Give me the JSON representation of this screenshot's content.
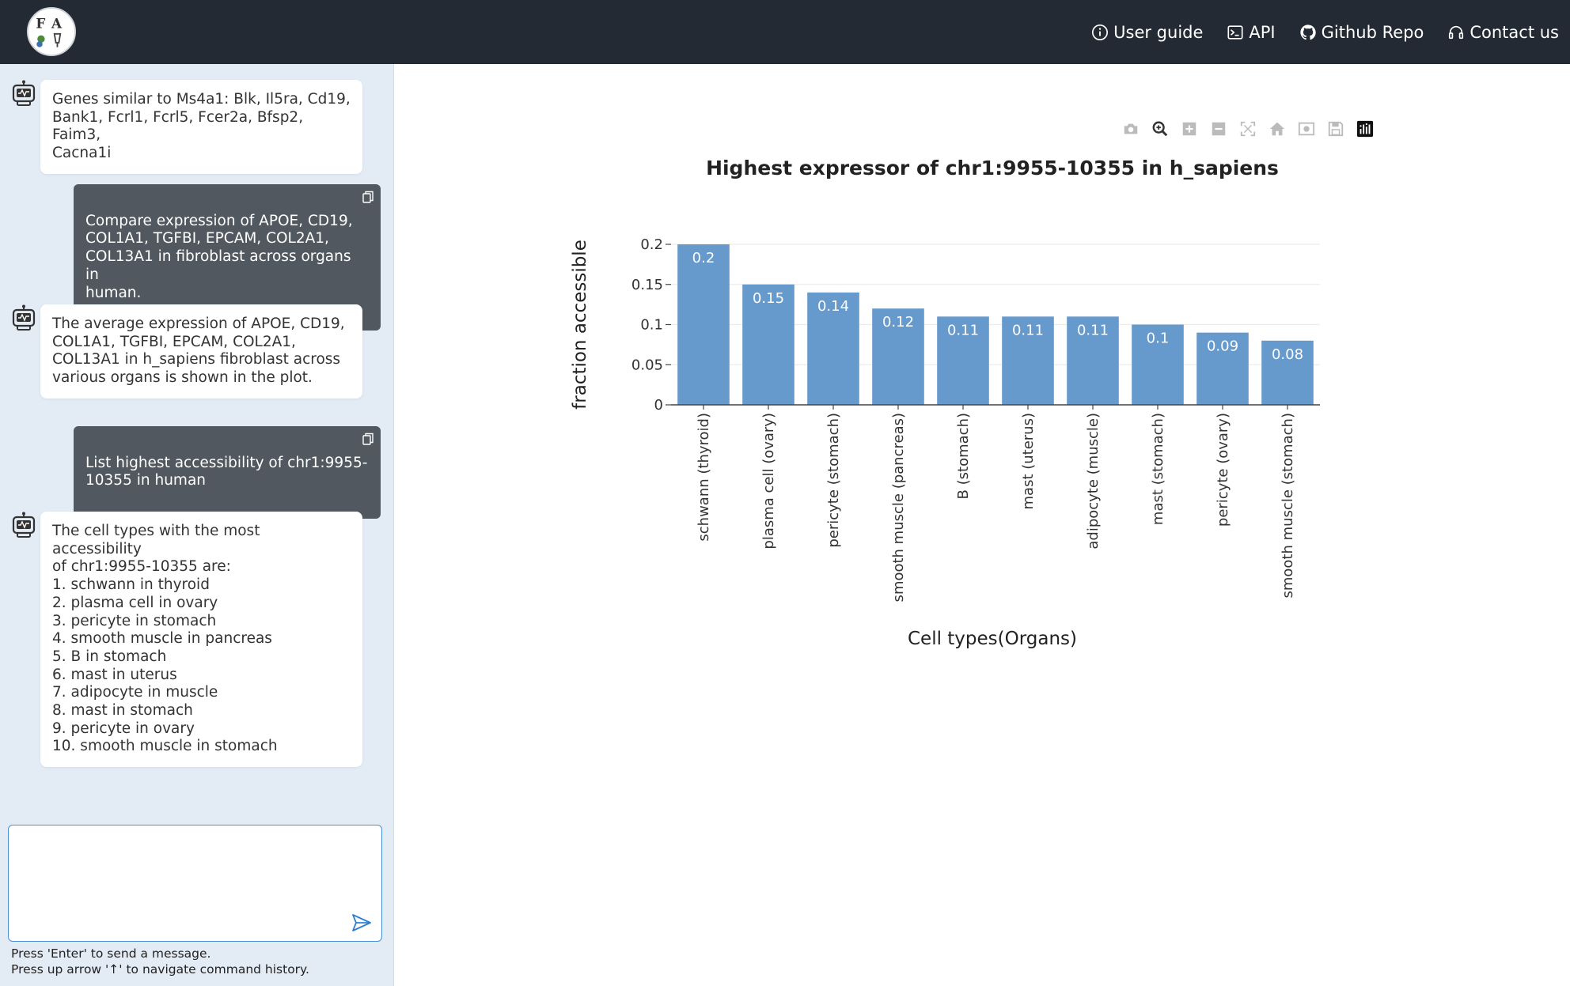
{
  "nav": {
    "links": [
      {
        "label": "User guide",
        "icon": "info-circle-icon"
      },
      {
        "label": "API",
        "icon": "terminal-icon"
      },
      {
        "label": "Github Repo",
        "icon": "github-icon"
      },
      {
        "label": "Contact us",
        "icon": "headset-icon"
      }
    ]
  },
  "chat": {
    "messages": [
      {
        "role": "bot",
        "text": "Genes similar to Ms4a1: Blk, Il5ra, Cd19,\nBank1, Fcrl1, Fcrl5, Fcer2a, Bfsp2, Faim3,\nCacna1i"
      },
      {
        "role": "user",
        "text": "Compare expression of APOE, CD19,\nCOL1A1, TGFBI, EPCAM, COL2A1,\nCOL13A1 in fibroblast across organs in\nhuman."
      },
      {
        "role": "bot",
        "text": "The average expression of APOE, CD19,\nCOL1A1, TGFBI, EPCAM, COL2A1,\nCOL13A1 in h_sapiens fibroblast across\nvarious organs is shown in the plot."
      },
      {
        "role": "user",
        "text": "List highest accessibility of chr1:9955-\n10355 in human"
      },
      {
        "role": "bot",
        "text": "The cell types with the most accessibility\nof chr1:9955-10355 are:\n1. schwann in thyroid\n2. plasma cell in ovary\n3. pericyte in stomach\n4. smooth muscle in pancreas\n5. B in stomach\n6. mast in uterus\n7. adipocyte in muscle\n8. mast in stomach\n9. pericyte in ovary\n10. smooth muscle in stomach"
      }
    ],
    "input_value": "",
    "hint_enter": "Press 'Enter' to send a message.",
    "hint_arrow": "Press up arrow '↑' to navigate command history."
  },
  "modebar": [
    "camera-icon",
    "zoom-icon",
    "zoom-in-icon",
    "zoom-out-icon",
    "autoscale-icon",
    "home-icon",
    "snapshot-icon",
    "save-icon",
    "plotly-logo-icon"
  ],
  "chart_data": {
    "type": "bar",
    "title": "Highest expressor of chr1:9955-10355 in h_sapiens",
    "xlabel": "Cell types(Organs)",
    "ylabel": "fraction accessible",
    "categories": [
      "schwann (thyroid)",
      "plasma cell (ovary)",
      "pericyte (stomach)",
      "smooth muscle (pancreas)",
      "B (stomach)",
      "mast (uterus)",
      "adipocyte (muscle)",
      "mast (stomach)",
      "pericyte (ovary)",
      "smooth muscle (stomach)"
    ],
    "values": [
      0.2,
      0.15,
      0.14,
      0.12,
      0.11,
      0.11,
      0.11,
      0.1,
      0.09,
      0.08
    ],
    "value_labels": [
      "0.2",
      "0.15",
      "0.14",
      "0.12",
      "0.11",
      "0.11",
      "0.11",
      "0.1",
      "0.09",
      "0.08"
    ],
    "yticks": [
      0,
      0.05,
      0.1,
      0.15,
      0.2
    ],
    "ytick_labels": [
      "0",
      "0.05",
      "0.1",
      "0.15",
      "0.2"
    ],
    "ylim": [
      0,
      0.2
    ],
    "bar_color": "#6699cc",
    "grid": true
  }
}
